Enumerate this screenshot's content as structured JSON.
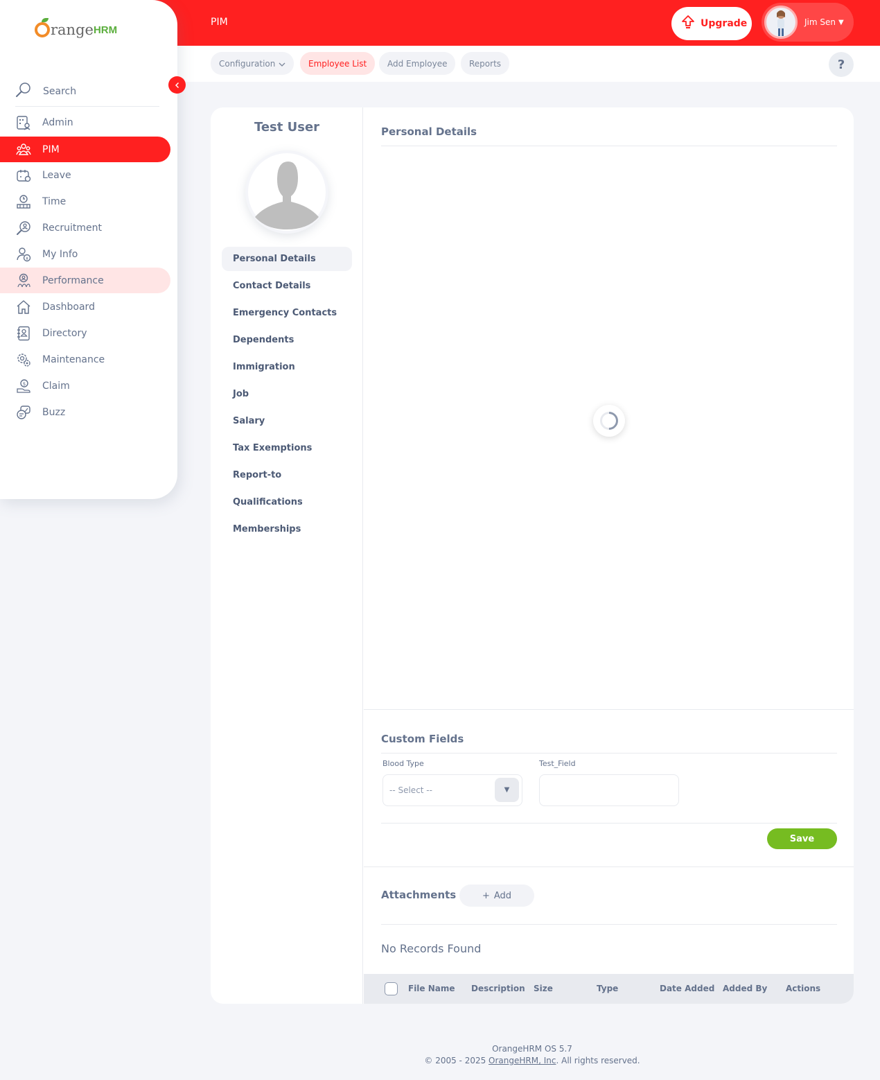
{
  "header": {
    "module_title": "PIM",
    "upgrade_label": "Upgrade",
    "user_name": "Jim Sen"
  },
  "subnav": {
    "tabs": [
      {
        "label": "Configuration",
        "has_caret": true
      },
      {
        "label": "Employee List",
        "active": true
      },
      {
        "label": "Add Employee"
      },
      {
        "label": "Reports"
      }
    ],
    "help_label": "?"
  },
  "sidebar": {
    "logo_text_1": "range",
    "logo_text_2": "HRM",
    "search_label": "Search",
    "items": [
      {
        "label": "Admin",
        "icon": "admin-icon"
      },
      {
        "label": "PIM",
        "icon": "pim-icon",
        "active": true
      },
      {
        "label": "Leave",
        "icon": "leave-icon"
      },
      {
        "label": "Time",
        "icon": "time-icon"
      },
      {
        "label": "Recruitment",
        "icon": "recruitment-icon"
      },
      {
        "label": "My Info",
        "icon": "my-info-icon"
      },
      {
        "label": "Performance",
        "icon": "performance-icon"
      },
      {
        "label": "Dashboard",
        "icon": "dashboard-icon"
      },
      {
        "label": "Directory",
        "icon": "directory-icon"
      },
      {
        "label": "Maintenance",
        "icon": "maintenance-icon"
      },
      {
        "label": "Claim",
        "icon": "claim-icon"
      },
      {
        "label": "Buzz",
        "icon": "buzz-icon"
      }
    ]
  },
  "employee": {
    "name": "Test User",
    "tabs": [
      "Personal Details",
      "Contact Details",
      "Emergency Contacts",
      "Dependents",
      "Immigration",
      "Job",
      "Salary",
      "Tax Exemptions",
      "Report-to",
      "Qualifications",
      "Memberships"
    ]
  },
  "personal_details": {
    "title": "Personal Details"
  },
  "custom_fields": {
    "title": "Custom Fields",
    "blood_type_label": "Blood Type",
    "blood_type_value": "-- Select --",
    "test_field_label": "Test_Field",
    "test_field_value": "",
    "save_label": "Save"
  },
  "attachments": {
    "title": "Attachments",
    "add_label": "Add",
    "add_icon": "+",
    "empty_text": "No Records Found",
    "columns": [
      "File Name",
      "Description",
      "Size",
      "Type",
      "Date Added",
      "Added By",
      "Actions"
    ]
  },
  "footer": {
    "version": "OrangeHRM OS 5.7",
    "copyright_prefix": "© 2005 - 2025 ",
    "company_link": "OrangeHRM, Inc",
    "copyright_suffix": ". All rights reserved."
  },
  "colors": {
    "brand": "#ff2020",
    "save": "#76bc21",
    "text": "#64728c"
  }
}
